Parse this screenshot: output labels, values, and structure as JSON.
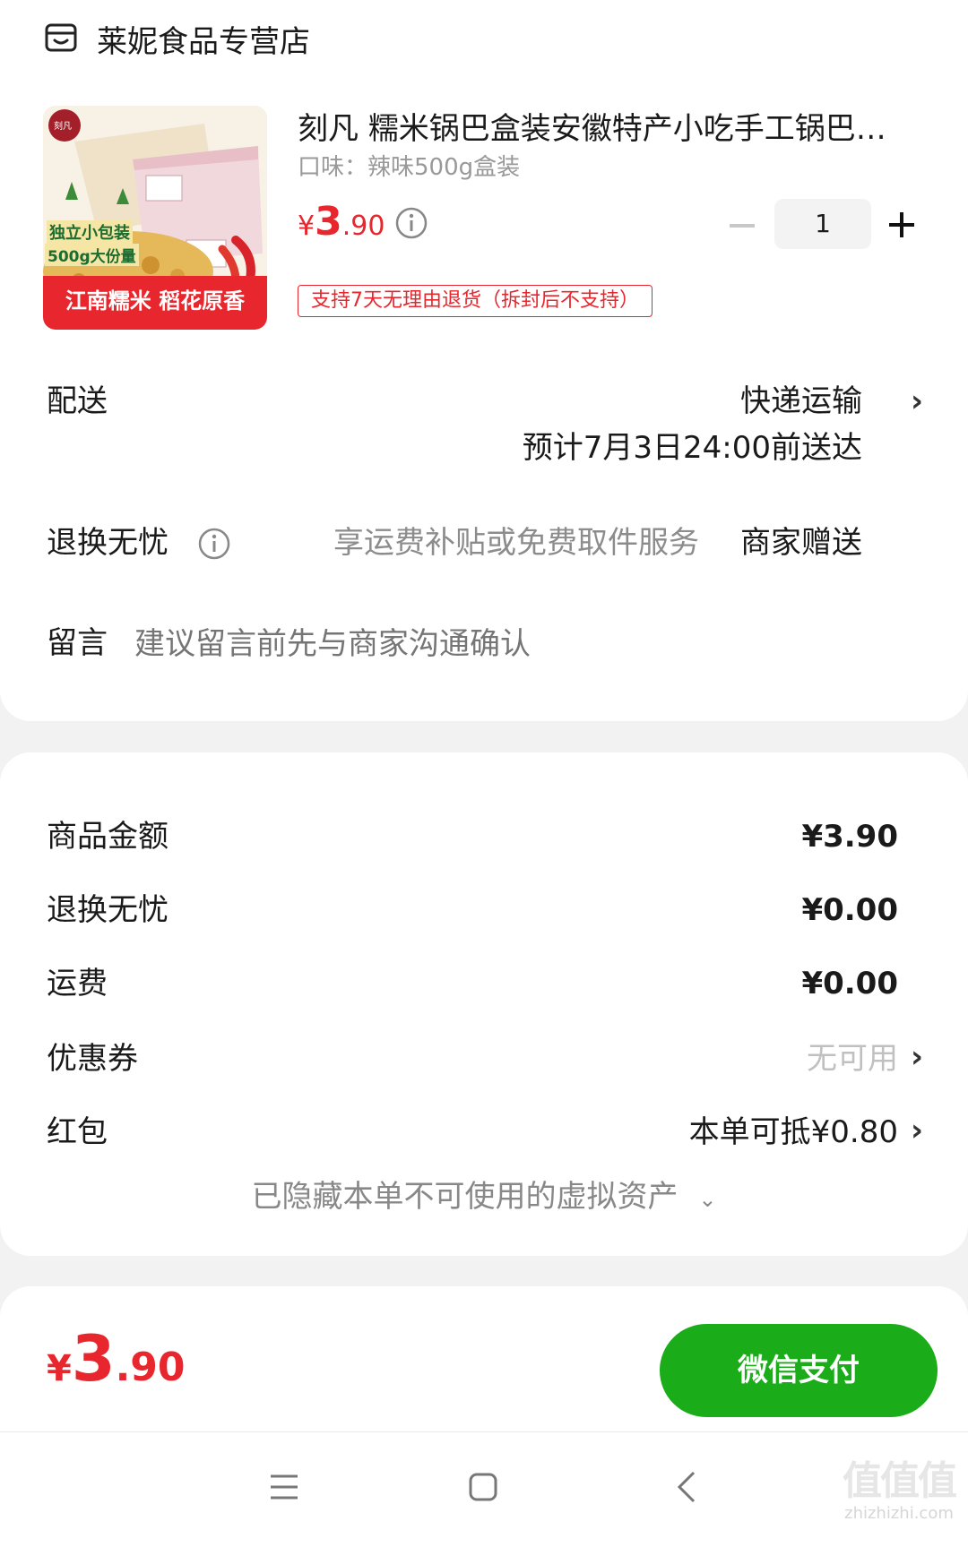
{
  "store": {
    "name": "莱妮食品专营店",
    "icon": "store-icon"
  },
  "product": {
    "image_texts": [
      "刻凡",
      "独立小包装",
      "500g大份量",
      "江南糯米 稻花原香"
    ],
    "title": "刻凡 糯米锅巴盒装安徽特产小吃手工锅巴…",
    "flavor": "口味：辣味500g盒装",
    "price_symbol": "¥",
    "price_int": "3",
    "price_dec": ".90",
    "quantity": "1",
    "return_tag": "支持7天无理由退货（拆封后不支持）"
  },
  "delivery": {
    "label": "配送",
    "method": "快递运输",
    "estimate": "预计7月3日24:00前送达"
  },
  "return_service": {
    "label": "退换无忧",
    "desc": "享运费补贴或免费取件服务",
    "status": "商家赠送"
  },
  "message": {
    "label": "留言",
    "placeholder": "建议留言前先与商家沟通确认"
  },
  "summary": {
    "goods_label": "商品金额",
    "goods_value": "¥3.90",
    "return_label": "退换无忧",
    "return_value": "¥0.00",
    "shipping_label": "运费",
    "shipping_value": "¥0.00",
    "coupon_label": "优惠券",
    "coupon_value": "无可用",
    "redpacket_label": "红包",
    "redpacket_value": "本单可抵¥0.80",
    "hidden_assets": "已隐藏本单不可使用的虚拟资产"
  },
  "footer": {
    "total_symbol": "¥",
    "total_int": "3",
    "total_dec": ".90",
    "pay_button": "微信支付"
  },
  "watermark": {
    "text": "值值值",
    "sub": "zhizhizhi.com"
  },
  "colors": {
    "price_red": "#e8262d",
    "pay_green": "#1aad19",
    "tag_border": "#e8262d"
  }
}
